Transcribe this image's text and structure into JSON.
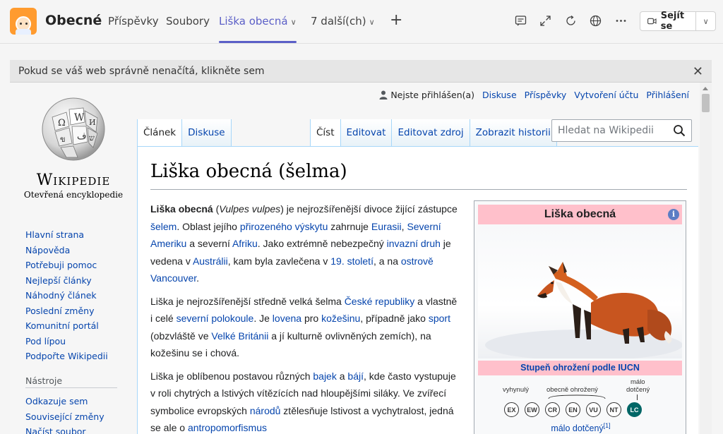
{
  "teams": {
    "team_name": "Obecné",
    "tabs": [
      {
        "label": "Příspěvky"
      },
      {
        "label": "Soubory"
      },
      {
        "label": "Liška obecná"
      },
      {
        "label": "7 další(ch)"
      }
    ],
    "meet_label": "Sejít se",
    "accent": "#5b5fc7"
  },
  "notice": {
    "text": "Pokud se váš web správně nenačítá, klikněte sem"
  },
  "wiki": {
    "wordmark": "Wikipedie",
    "tagline": "Otevřená encyklopedie",
    "personal": {
      "status": "Nejste přihlášen(a)",
      "links": [
        "Diskuse",
        "Příspěvky",
        "Vytvoření účtu",
        "Přihlášení"
      ]
    },
    "tabs_left": [
      "Článek",
      "Diskuse"
    ],
    "tabs_right": [
      "Číst",
      "Editovat",
      "Editovat zdroj",
      "Zobrazit historii"
    ],
    "search_placeholder": "Hledat na Wikipedii",
    "nav": [
      "Hlavní strana",
      "Nápověda",
      "Potřebuji pomoc",
      "Nejlepší články",
      "Náhodný článek",
      "Poslední změny",
      "Komunitní portál",
      "Pod lípou",
      "Podpořte Wikipedii"
    ],
    "tools_title": "Nástroje",
    "tools": [
      "Odkazuje sem",
      "Související změny",
      "Načíst soubor"
    ],
    "title": "Liška obecná (šelma)",
    "p1": {
      "t1": "Liška obecná",
      "t2": " (",
      "t3": "Vulpes vulpes",
      "t4": ") je nejrozšířenější divoce žijící zástupce ",
      "l1": "šelem",
      "t5": ". Oblast jejího ",
      "l2": "přirozeného výskytu",
      "t6": " zahrnuje ",
      "l3": "Eurasii",
      "t7": ", ",
      "l4": "Severní Ameriku",
      "t8": " a severní ",
      "l5": "Afriku",
      "t9": ". Jako extrémně nebezpečný ",
      "l6": "invazní druh",
      "t10": " je vedena v ",
      "l7": "Austrálii",
      "t11": ", kam byla zavlečena v ",
      "l8": "19. století",
      "t12": ", a na ",
      "l9": "ostrově Vancouver",
      "t13": "."
    },
    "p2": {
      "t1": "Liška je nejrozšířenější středně velká šelma ",
      "l1": "České republiky",
      "t2": " a vlastně i celé ",
      "l2": "severní polokoule",
      "t3": ". Je ",
      "l3": "lovena",
      "t4": " pro ",
      "l4": "kožešinu",
      "t5": ", případně jako ",
      "l5": "sport",
      "t6": " (obzvláště ve ",
      "l6": "Velké Británii",
      "t7": " a jí kulturně ovlivněných zemích), na kožešinu se i chová."
    },
    "p3": {
      "t1": "Liška je oblíbenou postavou různých ",
      "l1": "bajek",
      "t2": " a ",
      "l2": "bájí",
      "t3": ", kde často vystupuje v roli chytrých a lstivých vítězících nad hloupějšími siláky. Ve zvířecí symbolice evropských ",
      "l3": "národů",
      "t4": " ztělesňuje lstivost a vychytralost, jedná se ale o ",
      "l4": "antropomorfismus"
    },
    "infobox": {
      "title": "Liška obecná",
      "info_glyph": "i",
      "iucn_header": "Stupeň ohrožení podle IUCN",
      "label_extinct": "vyhynulý",
      "label_common": "obecně ohrožený",
      "label_lc_1": "málo",
      "label_lc_2": "dotčený",
      "codes": [
        "EX",
        "EW",
        "CR",
        "EN",
        "VU",
        "NT",
        "LC"
      ],
      "status": "málo dotčený",
      "ref": "[1]"
    }
  }
}
